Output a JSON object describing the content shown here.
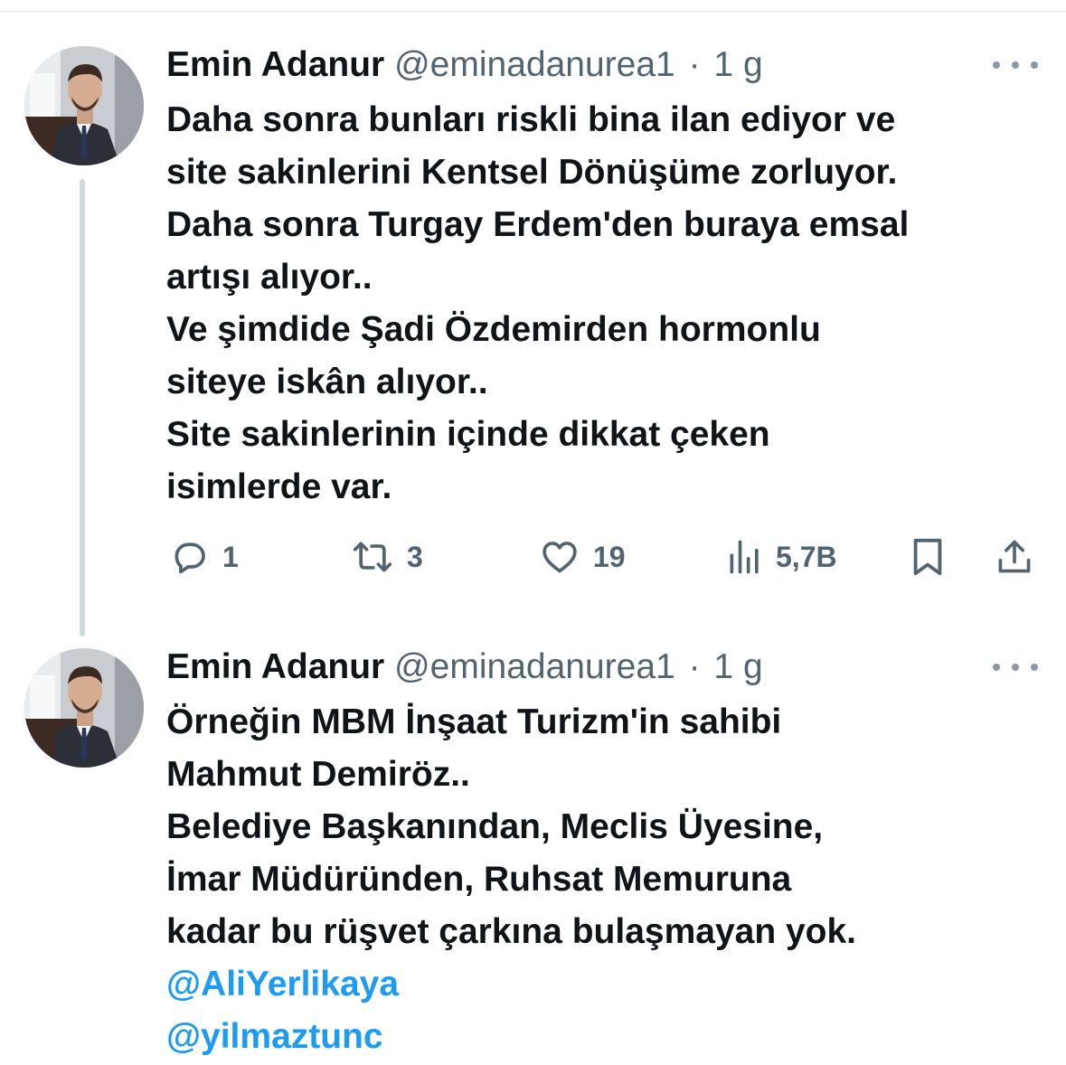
{
  "tweets": [
    {
      "author_name": "Emin Adanur",
      "handle": "@eminadanurea1",
      "separator": "·",
      "time": "1 g",
      "lines": [
        "Daha sonra bunları riskli bina ilan ediyor ve",
        "site sakinlerini Kentsel Dönüşüme zorluyor.",
        "Daha sonra Turgay Erdem'den buraya emsal",
        "artışı alıyor..",
        "Ve şimdide Şadi Özdemirden hormonlu",
        "siteye iskân alıyor..",
        "Site sakinlerinin içinde dikkat çeken",
        "isimlerde var."
      ],
      "actions": {
        "reply_count": "1",
        "retweet_count": "3",
        "like_count": "19",
        "view_count": "5,7B"
      }
    },
    {
      "author_name": "Emin Adanur",
      "handle": "@eminadanurea1",
      "separator": "·",
      "time": "1 g",
      "lines": [
        "Örneğin MBM İnşaat Turizm'in sahibi",
        "Mahmut Demiröz..",
        "Belediye Başkanından, Meclis Üyesine,",
        "İmar Müdüründen, Ruhsat Memuruna",
        "kadar bu rüşvet çarkına bulaşmayan yok."
      ],
      "mentions": [
        "@AliYerlikaya",
        "@yilmaztunc"
      ]
    }
  ],
  "icons": {
    "reply": "speech-bubble-icon",
    "retweet": "retweet-icon",
    "like": "heart-icon",
    "views": "bar-chart-icon",
    "bookmark": "bookmark-icon",
    "share": "share-icon",
    "more": "three-dots-icon"
  },
  "colors": {
    "text": "#0f1419",
    "secondary": "#536471",
    "link": "#1d9bf0",
    "thread_line": "#cfd9de"
  }
}
